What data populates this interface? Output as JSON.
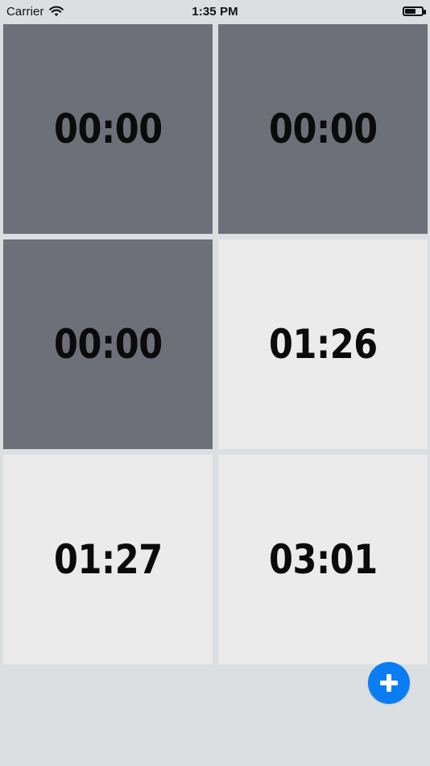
{
  "status_bar": {
    "carrier": "Carrier",
    "time": "1:35 PM",
    "icons": {
      "wifi": "wifi-icon",
      "battery": "battery-icon"
    },
    "battery_level": 0.58
  },
  "timers": [
    {
      "time": "00:00",
      "state": "dark"
    },
    {
      "time": "00:00",
      "state": "dark"
    },
    {
      "time": "00:00",
      "state": "dark"
    },
    {
      "time": "01:26",
      "state": "light"
    },
    {
      "time": "01:27",
      "state": "light"
    },
    {
      "time": "03:01",
      "state": "light"
    }
  ],
  "colors": {
    "background": "#dbdfe1",
    "tile_dark": "#6d7078",
    "tile_light": "#ebebeb",
    "accent": "#0b7df3"
  },
  "fab": {
    "icon": "plus-icon"
  }
}
